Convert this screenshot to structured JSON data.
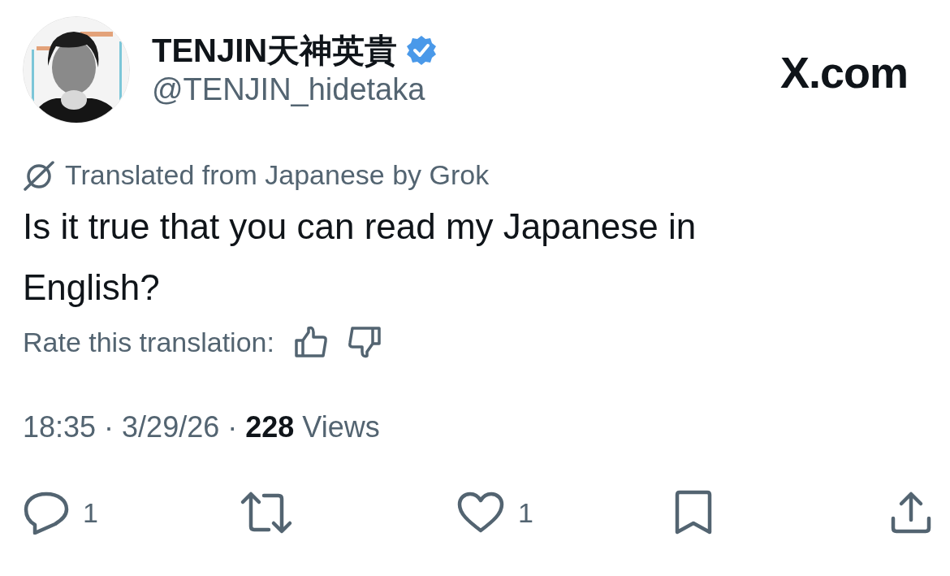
{
  "author": {
    "name": "TENJIN天神英貴",
    "handle": "@TENJIN_hidetaka",
    "verified": true
  },
  "logo": "X.com",
  "translation_note": "Translated from Japanese by Grok",
  "text": "Is it true that you can read my Japanese in English?",
  "rate_label": "Rate this translation:",
  "timestamp": "18:35 · 3/29/26 · **228** Views",
  "actions": [
    {
      "kind": "reply",
      "count": "1"
    },
    {
      "kind": "repost"
    },
    {
      "kind": "like",
      "count": "1"
    },
    {
      "kind": "bookmark"
    },
    {
      "kind": "share"
    }
  ]
}
